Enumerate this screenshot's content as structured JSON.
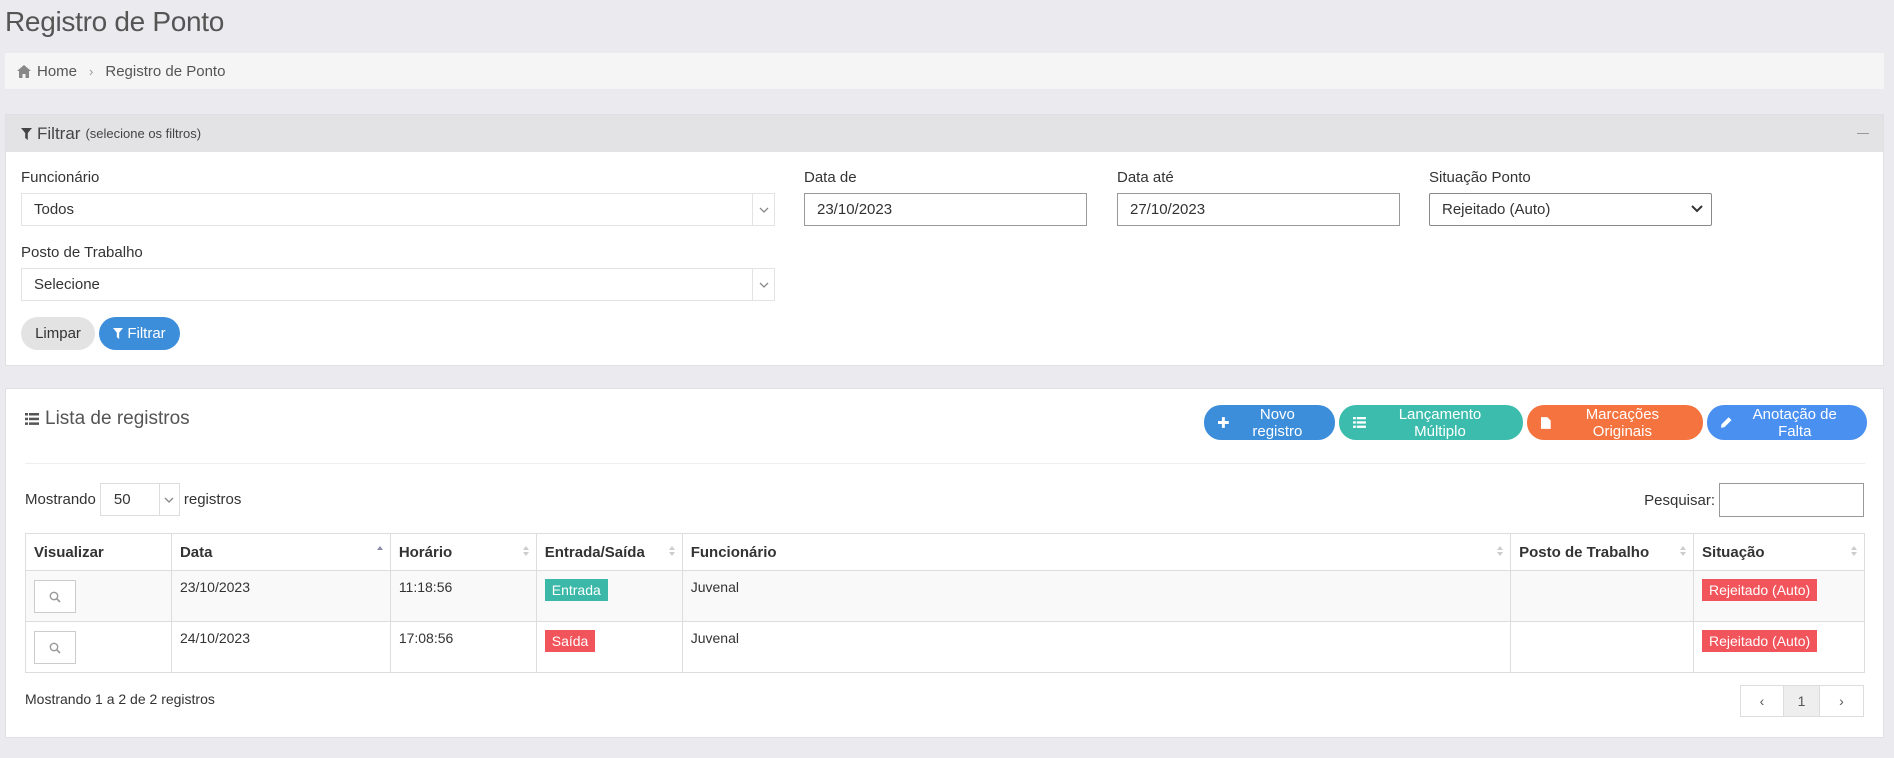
{
  "page": {
    "title": "Registro de Ponto"
  },
  "breadcrumb": {
    "home": "Home",
    "current": "Registro de Ponto"
  },
  "filter": {
    "title": "Filtrar",
    "subtitle": "(selecione os filtros)",
    "funcionario": {
      "label": "Funcionário",
      "value": "Todos"
    },
    "data_de": {
      "label": "Data de",
      "value": "23/10/2023"
    },
    "data_ate": {
      "label": "Data até",
      "value": "27/10/2023"
    },
    "situacao": {
      "label": "Situação Ponto",
      "value": "Rejeitado (Auto)"
    },
    "posto": {
      "label": "Posto de Trabalho",
      "value": "Selecione"
    },
    "clear_label": "Limpar",
    "filter_label": "Filtrar"
  },
  "list": {
    "title": "Lista de registros",
    "actions": {
      "new": "Novo registro",
      "multiple": "Lançamento Múltiplo",
      "original": "Marcações Originais",
      "absence": "Anotação de Falta"
    },
    "length": {
      "prefix": "Mostrando",
      "value": "50",
      "suffix": "registros"
    },
    "search_label": "Pesquisar:",
    "columns": [
      "Visualizar",
      "Data",
      "Horário",
      "Entrada/Saída",
      "Funcionário",
      "Posto de Trabalho",
      "Situação"
    ],
    "rows": [
      {
        "data": "23/10/2023",
        "horario": "11:18:56",
        "tipo": "Entrada",
        "funcionario": "Juvenal",
        "posto": "",
        "situacao": "Rejeitado (Auto)"
      },
      {
        "data": "24/10/2023",
        "horario": "17:08:56",
        "tipo": "Saída",
        "funcionario": "Juvenal",
        "posto": "",
        "situacao": "Rejeitado (Auto)"
      }
    ],
    "info": "Mostrando 1 a 2 de 2 registros",
    "pagination": {
      "prev": "‹",
      "current": "1",
      "next": "›"
    }
  },
  "colors": {
    "primary": "#3c8dda",
    "teal": "#3bbcac",
    "orange": "#f4733e",
    "blue": "#4a90f0",
    "entrada": "#3bb8a8",
    "saida": "#f2545b",
    "rejeitado": "#f2545b"
  }
}
